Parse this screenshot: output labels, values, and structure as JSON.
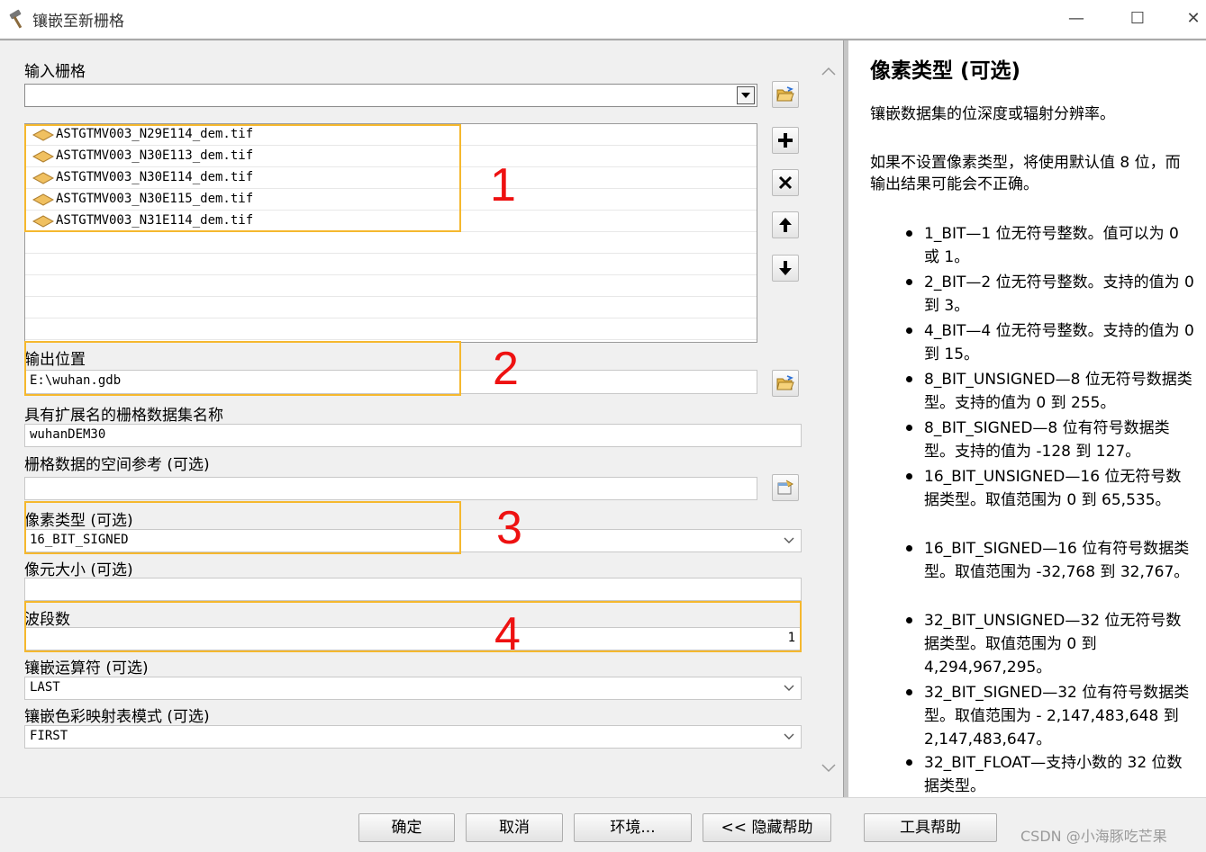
{
  "window": {
    "title": "镶嵌至新栅格",
    "controls": [
      "—",
      "☐",
      "✕"
    ]
  },
  "form": {
    "input_rasters_label": "输入栅格",
    "input_rasters_value": "",
    "raster_items": [
      "ASTGTMV003_N29E114_dem.tif",
      "ASTGTMV003_N30E113_dem.tif",
      "ASTGTMV003_N30E114_dem.tif",
      "ASTGTMV003_N30E115_dem.tif",
      "ASTGTMV003_N31E114_dem.tif"
    ],
    "output_location_label": "输出位置",
    "output_location_value": "E:\\wuhan.gdb",
    "dataset_name_label": "具有扩展名的栅格数据集名称",
    "dataset_name_value": "wuhanDEM30",
    "spatial_ref_label": "栅格数据的空间参考 (可选)",
    "spatial_ref_value": "",
    "pixel_type_label": "像素类型 (可选)",
    "pixel_type_value": "16_BIT_SIGNED",
    "cellsize_label": "像元大小 (可选)",
    "cellsize_value": "",
    "bands_label": "波段数",
    "bands_value": "1",
    "mosaic_operator_label": "镶嵌运算符 (可选)",
    "mosaic_operator_value": "LAST",
    "colormap_mode_label": "镶嵌色彩映射表模式 (可选)",
    "colormap_mode_value": "FIRST"
  },
  "annotations": [
    "1",
    "2",
    "3",
    "4"
  ],
  "help": {
    "title": "像素类型 (可选)",
    "para1": "镶嵌数据集的位深度或辐射分辨率。",
    "para2": "如果不设置像素类型，将使用默认值 8 位，而输出结果可能会不正确。",
    "items": [
      "1_BIT—1 位无符号整数。值可以为 0 或 1。",
      "2_BIT—2 位无符号整数。支持的值为 0 到 3。",
      "4_BIT—4 位无符号整数。支持的值为 0 到 15。",
      "8_BIT_UNSIGNED—8 位无符号数据类型。支持的值为 0 到 255。",
      "8_BIT_SIGNED—8 位有符号数据类型。支持的值为 -128 到 127。",
      "16_BIT_UNSIGNED—16 位无符号数据类型。取值范围为 0 到 65,535。",
      "16_BIT_SIGNED—16 位有符号数据类型。取值范围为 -32,768 到 32,767。",
      "32_BIT_UNSIGNED—32 位无符号数据类型。取值范围为 0 到 4,294,967,295。",
      "32_BIT_SIGNED—32 位有符号数据类型。取值范围为 - 2,147,483,648 到 2,147,483,647。",
      "32_BIT_FLOAT—支持小数的 32 位数据类型。"
    ]
  },
  "buttons": {
    "ok": "确定",
    "cancel": "取消",
    "environments": "环境...",
    "hide_help": "<< 隐藏帮助",
    "tool_help": "工具帮助"
  },
  "watermark": "CSDN @小海豚吃芒果",
  "colors": {
    "highlight": "#f5b82e",
    "annotation": "#ee1111"
  }
}
